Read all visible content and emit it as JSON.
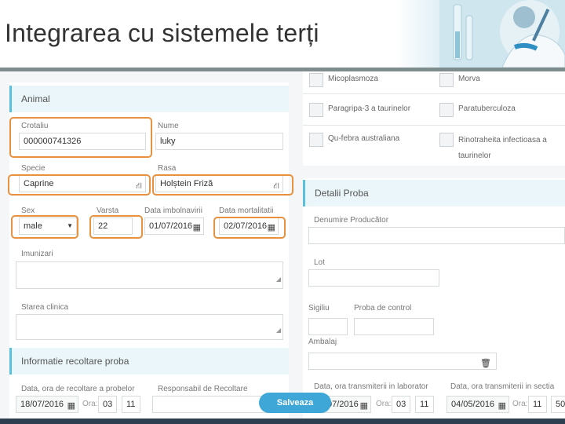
{
  "slide": {
    "title": "Integrarea cu sistemele terți"
  },
  "animal": {
    "section_title": "Animal",
    "crotaliu_label": "Crotaliu",
    "crotaliu_value": "000000741326",
    "nume_label": "Nume",
    "nume_value": "luky",
    "specie_label": "Specie",
    "specie_value": "Caprine",
    "rasa_label": "Rasa",
    "rasa_value": "Holștein Friză",
    "sex_label": "Sex",
    "sex_value": "male",
    "varsta_label": "Varsta",
    "varsta_value": "22",
    "data_imbolnavirii_label": "Data imbolnavirii",
    "data_imbolnavirii_value": "01/07/2016",
    "data_mortalitatii_label": "Data mortalitatii",
    "data_mortalitatii_value": "02/07/2016",
    "imunizari_label": "Imunizari",
    "starea_clinica_label": "Starea clinica"
  },
  "recoltare": {
    "section_title": "Informatie recoltare proba",
    "data_ora_label": "Data, ora de recoltare a probelor",
    "data_value": "18/07/2016",
    "ora_label": "Ora:",
    "ora_h": "03",
    "ora_m": "11",
    "responsabil_label": "Responsabil de Recoltare"
  },
  "diseases": [
    {
      "label": "Micoplasmoza"
    },
    {
      "label": "Morva"
    },
    {
      "label": "Paragripa-3 a taurinelor"
    },
    {
      "label": "Paratuberculoza"
    },
    {
      "label": "Qu-febra australiana"
    },
    {
      "label": "Rinotraheita infectioasa a taurinelor"
    }
  ],
  "proba": {
    "section_title": "Detalii Proba",
    "producator_label": "Denumire Producător",
    "lot_label": "Lot",
    "sigiliu_label": "Sigiliu",
    "proba_control_label": "Proba de control",
    "ambalaj_label": "Ambalaj",
    "transmiterii_label": "Data, ora transmiterii in laborator",
    "transmiterii_date": "07/2016",
    "transmiterii_ora_label": "Ora:",
    "transmiterii_h": "03",
    "transmiterii_m": "11",
    "sectie_label": "Data, ora transmiterii in sectia",
    "sectie_date": "04/05/2016",
    "sectie_ora_label": "Ora:",
    "sectie_h": "11",
    "sectie_m": "50"
  },
  "actions": {
    "save_label": "Salveaza"
  },
  "colors": {
    "accent": "#5bc0de",
    "highlight": "#e8913e",
    "save_button": "#3fa7d8"
  }
}
